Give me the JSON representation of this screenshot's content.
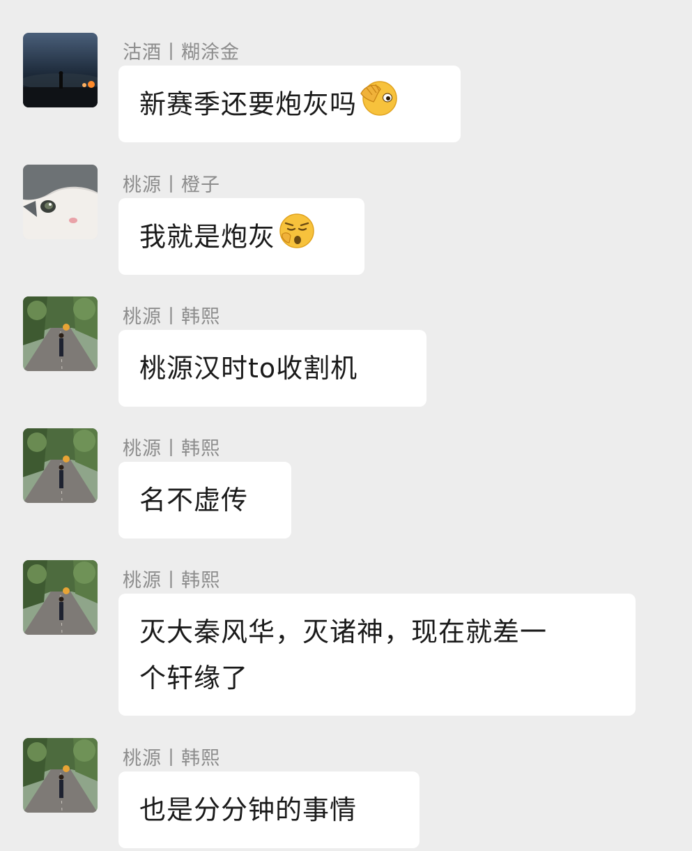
{
  "messages": [
    {
      "sender": "沽酒丨糊涂金",
      "text": "新赛季还要炮灰吗",
      "emoji": "facepalm-peek-emoji",
      "avatar": "night-lakeside-figure-avatar"
    },
    {
      "sender": "桃源丨橙子",
      "text": "我就是炮灰",
      "emoji": "sad-shush-emoji",
      "avatar": "gray-cat-avatar"
    },
    {
      "sender": "桃源丨韩熙",
      "text": "桃源汉时to收割机",
      "avatar": "tree-road-person-avatar"
    },
    {
      "sender": "桃源丨韩熙",
      "text": "名不虚传",
      "avatar": "tree-road-person-avatar"
    },
    {
      "sender": "桃源丨韩熙",
      "text_line1": "灭大秦风华，灭诸神，现在就差一",
      "text_line2": "个轩缘了",
      "avatar": "tree-road-person-avatar"
    },
    {
      "sender": "桃源丨韩熙",
      "text": "也是分分钟的事情",
      "avatar": "tree-road-person-avatar"
    }
  ],
  "colors": {
    "background": "#ededed",
    "bubble": "#ffffff",
    "sender_text": "#8c8c8c",
    "message_text": "#1a1a1a",
    "emoji_yellow": "#f7c23c"
  }
}
